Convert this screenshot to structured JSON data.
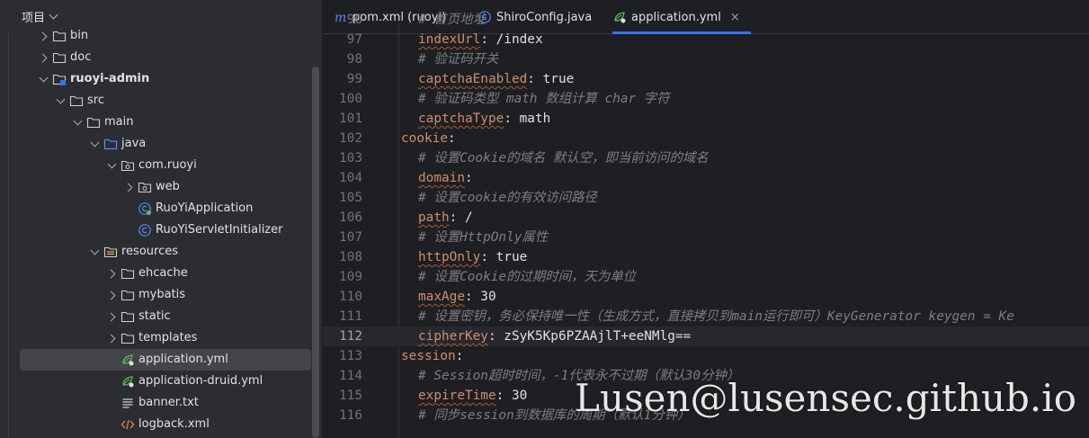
{
  "project_panel": {
    "title": "项目",
    "tree": [
      {
        "label": "bin",
        "depth": 2,
        "arrow": "right",
        "icon": "folder-icon"
      },
      {
        "label": "doc",
        "depth": 2,
        "arrow": "right",
        "icon": "folder-icon"
      },
      {
        "label": "ruoyi-admin",
        "depth": 2,
        "arrow": "down",
        "icon": "module-folder-icon",
        "bold": true
      },
      {
        "label": "src",
        "depth": 3,
        "arrow": "down",
        "icon": "folder-icon"
      },
      {
        "label": "main",
        "depth": 4,
        "arrow": "down",
        "icon": "folder-icon"
      },
      {
        "label": "java",
        "depth": 5,
        "arrow": "down",
        "icon": "source-folder-icon"
      },
      {
        "label": "com.ruoyi",
        "depth": 6,
        "arrow": "down",
        "icon": "package-icon"
      },
      {
        "label": "web",
        "depth": 7,
        "arrow": "right",
        "icon": "package-icon"
      },
      {
        "label": "RuoYiApplication",
        "depth": 7,
        "arrow": "none",
        "icon": "spring-class-icon"
      },
      {
        "label": "RuoYiServletInitializer",
        "depth": 7,
        "arrow": "none",
        "icon": "class-icon"
      },
      {
        "label": "resources",
        "depth": 5,
        "arrow": "down",
        "icon": "resources-folder-icon"
      },
      {
        "label": "ehcache",
        "depth": 6,
        "arrow": "right",
        "icon": "folder-icon"
      },
      {
        "label": "mybatis",
        "depth": 6,
        "arrow": "right",
        "icon": "folder-icon"
      },
      {
        "label": "static",
        "depth": 6,
        "arrow": "right",
        "icon": "folder-icon"
      },
      {
        "label": "templates",
        "depth": 6,
        "arrow": "right",
        "icon": "folder-icon"
      },
      {
        "label": "application.yml",
        "depth": 6,
        "arrow": "none",
        "icon": "spring-yaml-icon",
        "selected": true
      },
      {
        "label": "application-druid.yml",
        "depth": 6,
        "arrow": "none",
        "icon": "spring-yaml-icon"
      },
      {
        "label": "banner.txt",
        "depth": 6,
        "arrow": "none",
        "icon": "text-file-icon"
      },
      {
        "label": "logback.xml",
        "depth": 6,
        "arrow": "none",
        "icon": "xml-file-icon"
      }
    ]
  },
  "tabs": [
    {
      "label": "pom.xml (ruoyi)",
      "icon": "maven-icon",
      "active": false
    },
    {
      "label": "ShiroConfig.java",
      "icon": "class-icon",
      "active": false
    },
    {
      "label": "application.yml",
      "icon": "spring-yaml-icon",
      "active": true,
      "close": "×"
    }
  ],
  "code_lines": [
    {
      "n": "96",
      "indent": 2,
      "parts": [
        {
          "t": "# 首页地址",
          "c": "c"
        }
      ]
    },
    {
      "n": "97",
      "indent": 2,
      "parts": [
        {
          "t": "indexUrl",
          "c": "k uw"
        },
        {
          "t": ": /index",
          "c": "v"
        }
      ]
    },
    {
      "n": "98",
      "indent": 2,
      "parts": [
        {
          "t": "# 验证码开关",
          "c": "c"
        }
      ]
    },
    {
      "n": "99",
      "indent": 2,
      "parts": [
        {
          "t": "captchaEnabled",
          "c": "k uw"
        },
        {
          "t": ": true",
          "c": "v"
        }
      ]
    },
    {
      "n": "100",
      "indent": 2,
      "parts": [
        {
          "t": "# 验证码类型 math 数组计算 char 字符",
          "c": "c"
        }
      ]
    },
    {
      "n": "101",
      "indent": 2,
      "parts": [
        {
          "t": "captchaType",
          "c": "k uw"
        },
        {
          "t": ": math",
          "c": "v"
        }
      ]
    },
    {
      "n": "102",
      "indent": 1,
      "parts": [
        {
          "t": "cookie",
          "c": "k"
        },
        {
          "t": ":",
          "c": "v"
        }
      ]
    },
    {
      "n": "103",
      "indent": 2,
      "parts": [
        {
          "t": "# 设置Cookie的域名 默认空，即当前访问的域名",
          "c": "c"
        }
      ]
    },
    {
      "n": "104",
      "indent": 2,
      "parts": [
        {
          "t": "domain",
          "c": "k uw"
        },
        {
          "t": ":",
          "c": "v"
        }
      ]
    },
    {
      "n": "105",
      "indent": 2,
      "parts": [
        {
          "t": "# 设置cookie的有效访问路径",
          "c": "c"
        }
      ]
    },
    {
      "n": "106",
      "indent": 2,
      "parts": [
        {
          "t": "path",
          "c": "k uw"
        },
        {
          "t": ": /",
          "c": "v"
        }
      ]
    },
    {
      "n": "107",
      "indent": 2,
      "parts": [
        {
          "t": "# 设置HttpOnly属性",
          "c": "c"
        }
      ]
    },
    {
      "n": "108",
      "indent": 2,
      "parts": [
        {
          "t": "httpOnly",
          "c": "k uw"
        },
        {
          "t": ": true",
          "c": "v"
        }
      ]
    },
    {
      "n": "109",
      "indent": 2,
      "parts": [
        {
          "t": "# 设置Cookie的过期时间，天为单位",
          "c": "c"
        }
      ]
    },
    {
      "n": "110",
      "indent": 2,
      "parts": [
        {
          "t": "maxAge",
          "c": "k uw"
        },
        {
          "t": ": 30",
          "c": "v"
        }
      ]
    },
    {
      "n": "111",
      "indent": 2,
      "parts": [
        {
          "t": "# 设置密钥，务必保持唯一性（生成方式，直接拷贝到main运行即可）KeyGenerator keygen = Ke",
          "c": "c"
        }
      ]
    },
    {
      "n": "112",
      "indent": 2,
      "current": true,
      "parts": [
        {
          "t": "cipherKey",
          "c": "k uw"
        },
        {
          "t": ": zSyK5Kp6PZAAjlT+eeNMlg==",
          "c": "v"
        }
      ]
    },
    {
      "n": "113",
      "indent": 1,
      "parts": [
        {
          "t": "session",
          "c": "k"
        },
        {
          "t": ":",
          "c": "v"
        }
      ]
    },
    {
      "n": "114",
      "indent": 2,
      "parts": [
        {
          "t": "# Session超时时间，-1代表永不过期（默认30分钟）",
          "c": "c"
        }
      ]
    },
    {
      "n": "115",
      "indent": 2,
      "parts": [
        {
          "t": "expireTime",
          "c": "k uw"
        },
        {
          "t": ": 30",
          "c": "v"
        }
      ]
    },
    {
      "n": "116",
      "indent": 2,
      "parts": [
        {
          "t": "# 同步session到数据库的周期（默认1分钟）",
          "c": "c"
        }
      ]
    }
  ],
  "watermark": "Lusen@lusensec.github.io",
  "colors": {
    "accent": "#3574f0",
    "key": "#cf8e6d",
    "comment": "#7a7e85",
    "selection": "#43454a"
  }
}
